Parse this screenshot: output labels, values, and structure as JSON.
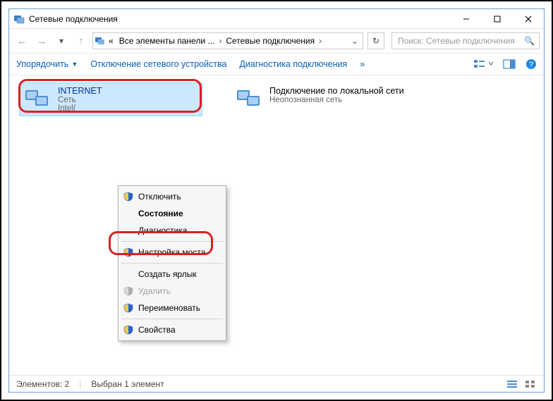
{
  "titlebar": {
    "title": "Сетевые подключения"
  },
  "nav": {
    "segment1": "Все элементы панели ...",
    "segment2": "Сетевые подключения",
    "search_placeholder": "Поиск: Сетевые подключения"
  },
  "toolbar": {
    "organize": "Упорядочить",
    "disable_device": "Отключение сетевого устройства",
    "diagnose": "Диагностика подключения",
    "overflow": "»"
  },
  "items": {
    "internet": {
      "name": "INTERNET",
      "line2": "Сеть",
      "line3": "Intel("
    },
    "lan": {
      "name": "Подключение по локальной сети",
      "line2": "Неопознанная сеть"
    }
  },
  "context_menu": {
    "disable": "Отключить",
    "status": "Состояние",
    "diagnose": "Диагностика",
    "bridge": "Настройка моста",
    "shortcut": "Создать ярлык",
    "delete": "Удалить",
    "rename": "Переименовать",
    "properties": "Свойства"
  },
  "statusbar": {
    "count": "Элементов: 2",
    "selected": "Выбран 1 элемент"
  }
}
